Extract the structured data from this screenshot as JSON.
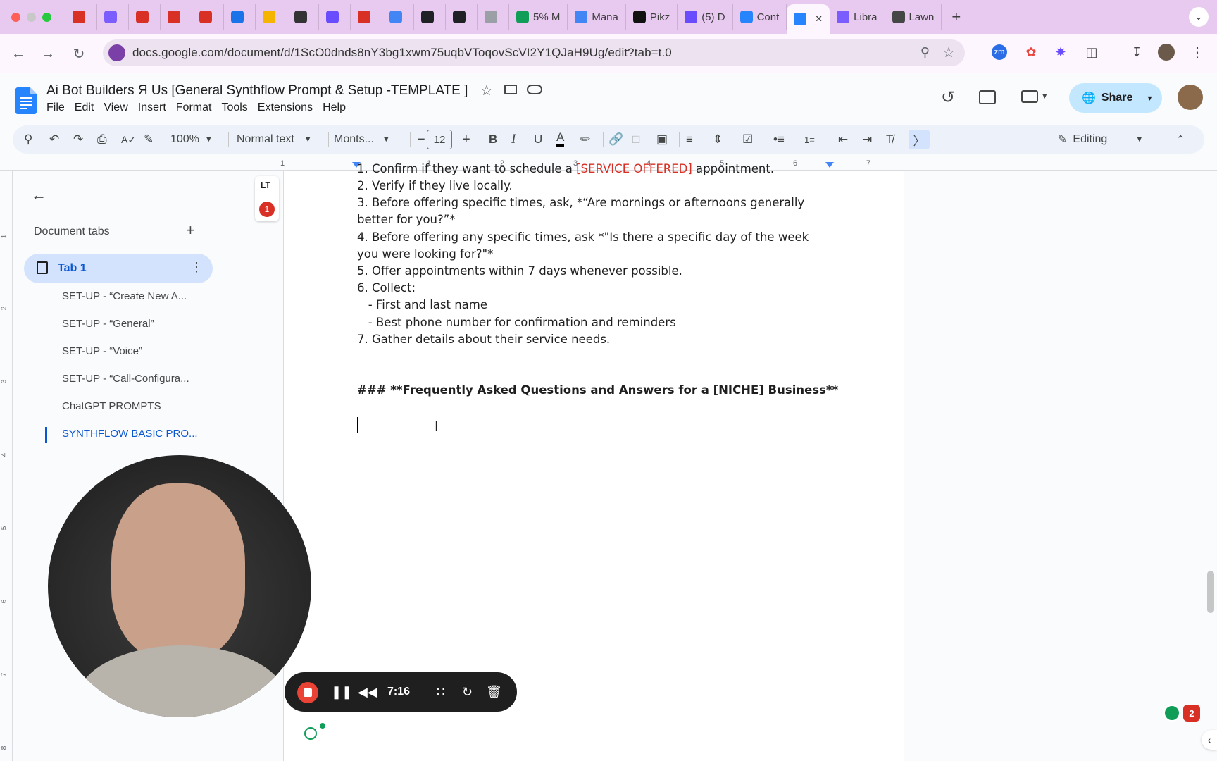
{
  "browser": {
    "tabs": [
      {
        "label": "",
        "icon": "record-icon",
        "color": "#d93025"
      },
      {
        "label": "",
        "icon": "spark-icon",
        "color": "#7b5cff"
      },
      {
        "label": "",
        "icon": "gmail-icon",
        "color": "#d93025"
      },
      {
        "label": "",
        "icon": "gmail-icon",
        "color": "#d93025"
      },
      {
        "label": "",
        "icon": "gmail-icon",
        "color": "#d93025"
      },
      {
        "label": "",
        "icon": "calendar-icon",
        "color": "#1a73e8"
      },
      {
        "label": "",
        "icon": "trello-icon",
        "color": "#f4b400"
      },
      {
        "label": "",
        "icon": "book-icon",
        "color": "#333333"
      },
      {
        "label": "",
        "icon": "s-icon",
        "color": "#6a4cff"
      },
      {
        "label": "",
        "icon": "sk-icon",
        "color": "#d93025"
      },
      {
        "label": "",
        "icon": "loop-icon",
        "color": "#4285f4"
      },
      {
        "label": "",
        "icon": "s-dark-icon",
        "color": "#202124"
      },
      {
        "label": "",
        "icon": "p-icon",
        "color": "#202124"
      },
      {
        "label": "",
        "icon": "reader-icon",
        "color": "#9aa0a6"
      },
      {
        "label": "5% M",
        "icon": "sheets-icon",
        "color": "#0f9d58"
      },
      {
        "label": "Mana",
        "icon": "google-icon",
        "color": "#4285f4"
      },
      {
        "label": "Pikz",
        "icon": "pikzels-icon",
        "color": "#111111"
      },
      {
        "label": "(5) D",
        "icon": "badge-icon",
        "color": "#6a4cff"
      },
      {
        "label": "Cont",
        "icon": "docs-icon",
        "color": "#2684fc"
      },
      {
        "label": "",
        "icon": "docs-record-icon",
        "color": "#2684fc"
      },
      {
        "label": "Libra",
        "icon": "spark-icon",
        "color": "#7b5cff"
      },
      {
        "label": "Lawn",
        "icon": "openai-icon",
        "color": "#444746"
      }
    ],
    "url": "docs.google.com/document/d/1ScO0dnds8nY3bg1xwm75uqbVToqovScVI2Y1QJaH9Ug/edit?tab=t.0"
  },
  "doc": {
    "title": "Ai Bot Builders Я Us [General Synthflow Prompt & Setup -TEMPLATE ]",
    "menu": [
      "File",
      "Edit",
      "View",
      "Insert",
      "Format",
      "Tools",
      "Extensions",
      "Help"
    ],
    "share_label": "Share",
    "editing_label": "Editing"
  },
  "toolbar": {
    "zoom": "100%",
    "style": "Normal text",
    "font": "Monts...",
    "font_size": "12"
  },
  "ruler": [
    "1",
    "1",
    "2",
    "3",
    "4",
    "5",
    "6",
    "7"
  ],
  "vruler": [
    "1",
    "2",
    "3",
    "4",
    "5",
    "6",
    "7",
    "8"
  ],
  "sidebar": {
    "header": "Document tabs",
    "active_tab": "Tab 1",
    "items": [
      "SET-UP - “Create New A...",
      "SET-UP - “General”",
      "SET-UP - “Voice”",
      "SET-UP - “Call-Configura...",
      "ChatGPT PROMPTS",
      "SYNTHFLOW BASIC PRO..."
    ],
    "badge_count": "1"
  },
  "content": {
    "lines": [
      "2. Verify if they live locally.",
      "3. Before offering specific times, ask, *“Are mornings or afternoons generally",
      "better for you?”*",
      "4. Before offering any specific times, ask *\"Is there a specific day of the week",
      "you were looking for?\"*",
      "5. Offer appointments within 7 days whenever possible.",
      "6. Collect:",
      "   - First and last name",
      "   - Best phone number for confirmation and reminders",
      "7. Gather details about their service needs."
    ],
    "heading": "### **Frequently Asked Questions and Answers for a [NICHE] Business**"
  },
  "recorder": {
    "time": "7:16"
  },
  "notifications": {
    "count": "2"
  },
  "colors": {
    "tabstrip": "#e8c9f0",
    "toolbar": "#edf2fa",
    "share_button": "#c2e7ff",
    "active_doc_tab": "#d3e3fd",
    "accent": "#1a73e8",
    "record_red": "#ea4335"
  }
}
